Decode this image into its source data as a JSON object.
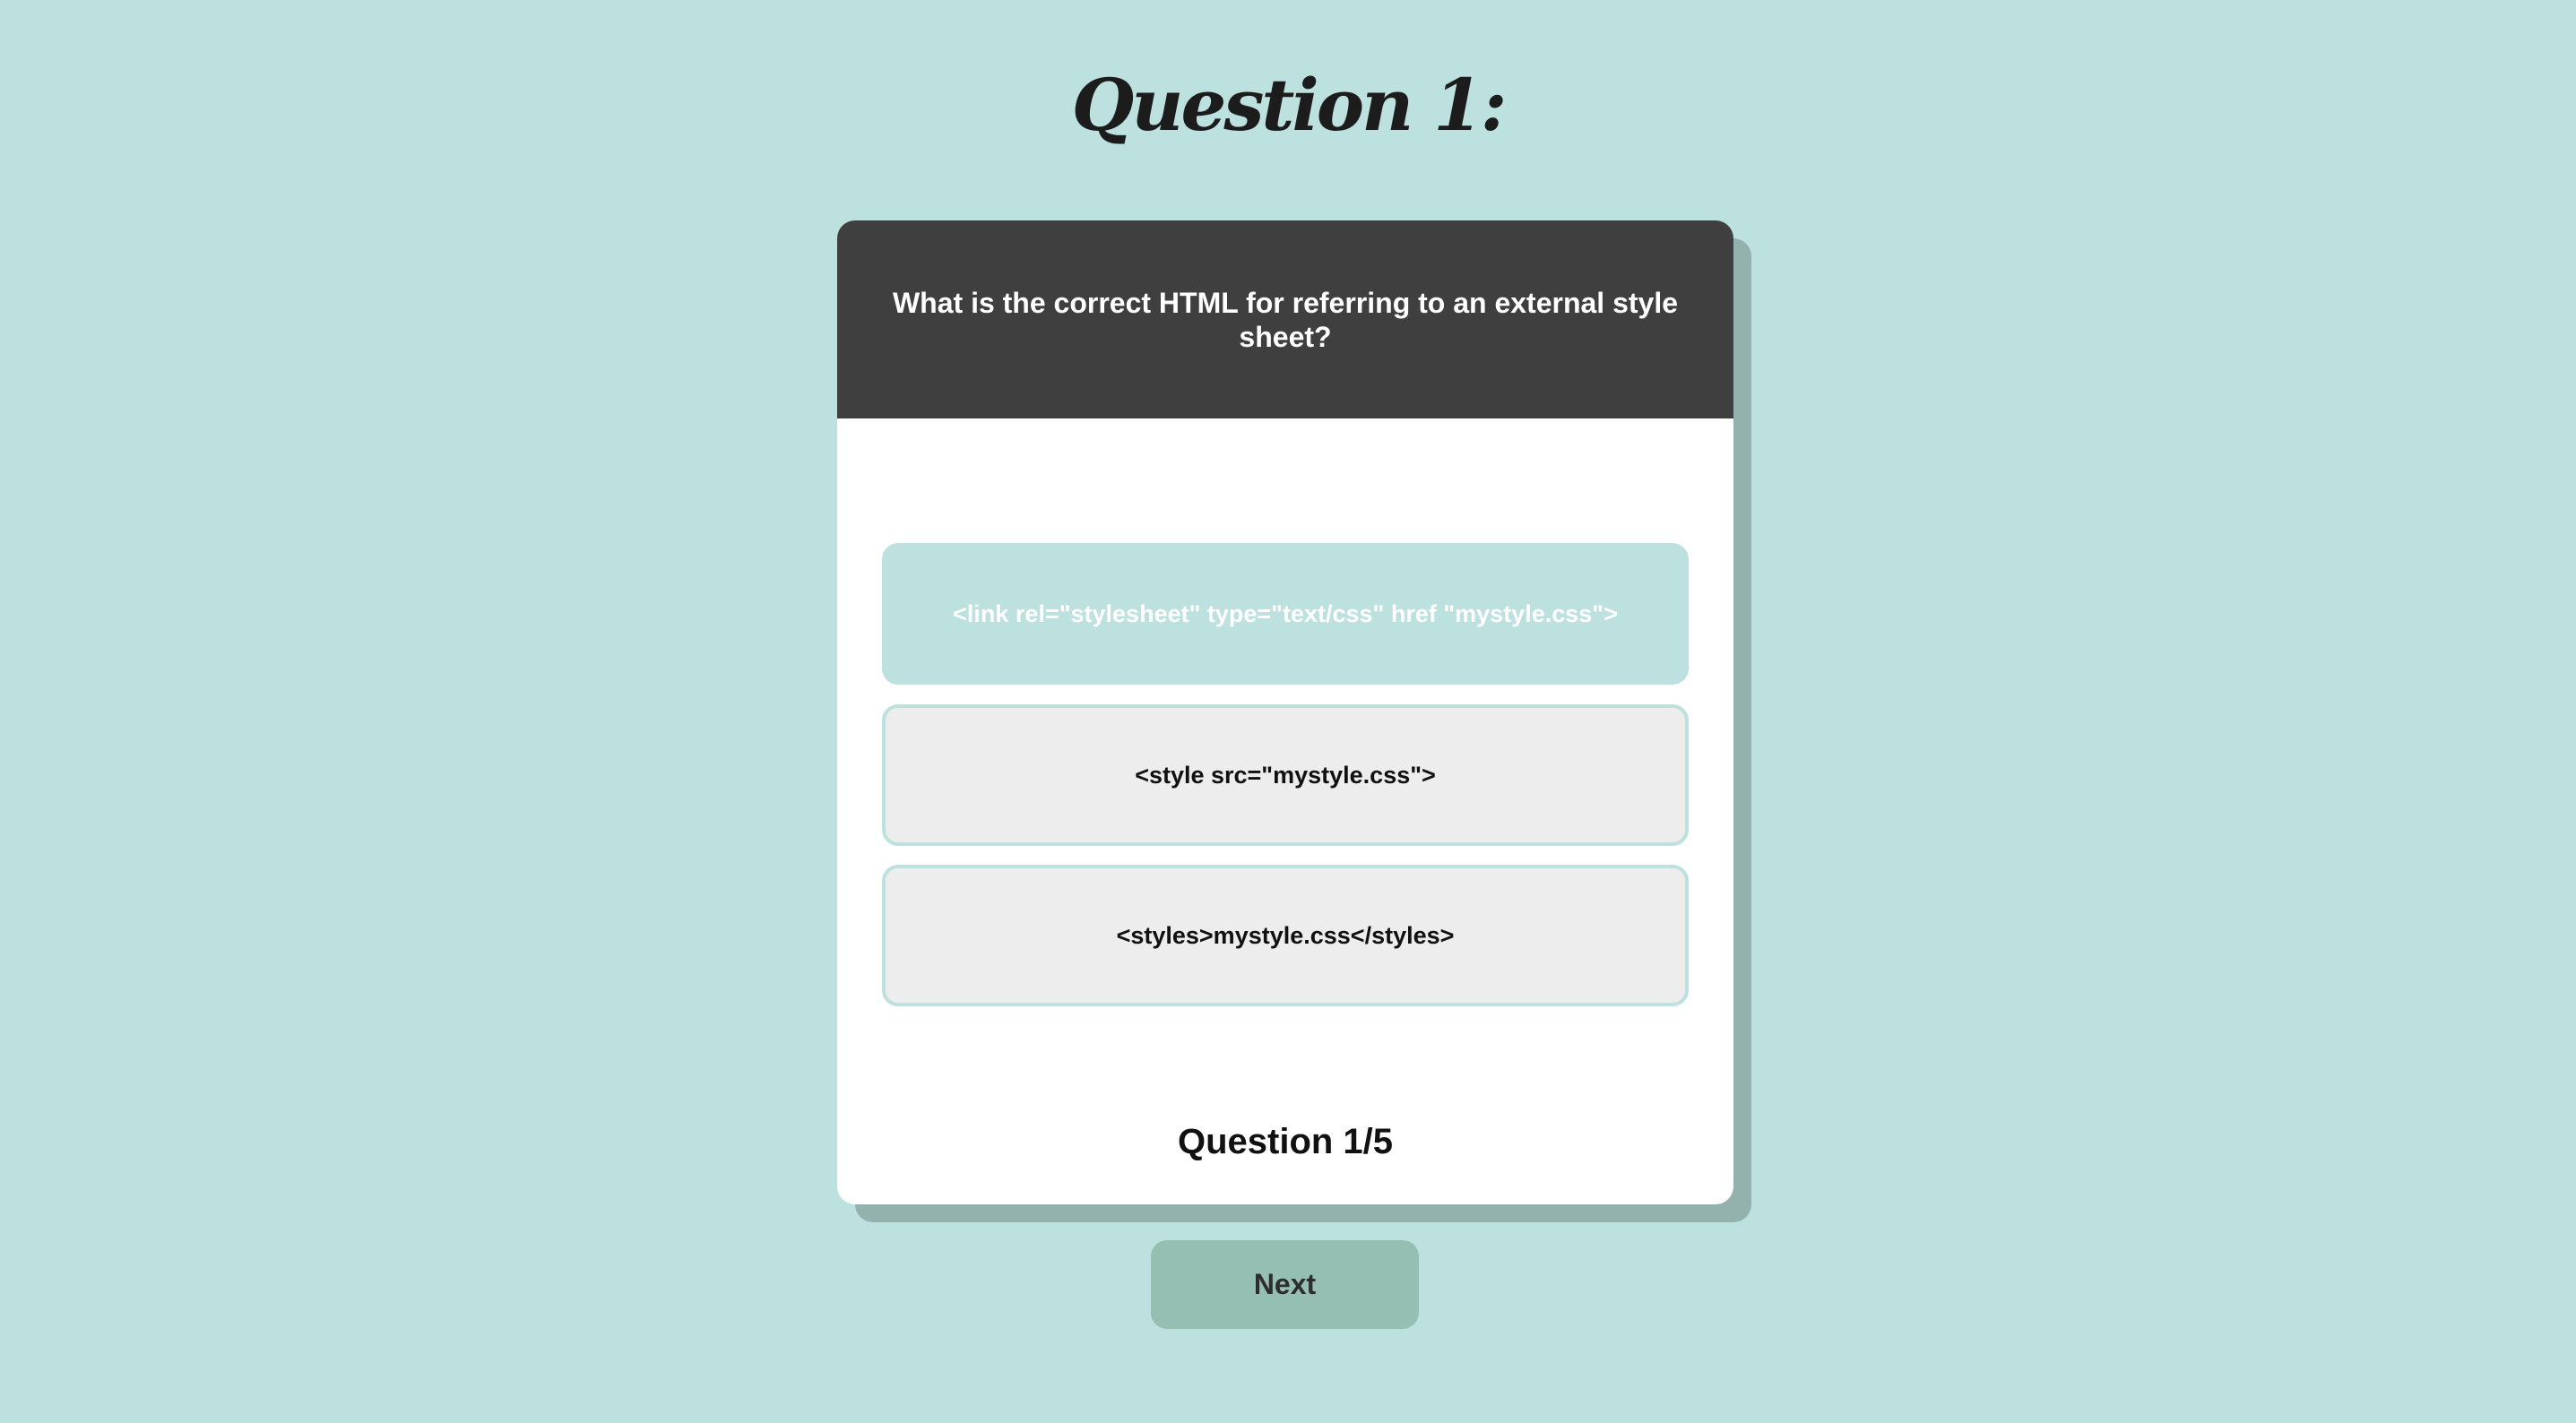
{
  "page": {
    "title": "Question 1:"
  },
  "question": {
    "text": "What is the correct HTML for referring to an external style sheet?"
  },
  "answers": [
    {
      "label": "<link rel=\"stylesheet\" type=\"text/css\" href \"mystyle.css\">",
      "state": "selected"
    },
    {
      "label": "<style src=\"mystyle.css\">",
      "state": "default"
    },
    {
      "label": "<styles>mystyle.css</styles>",
      "state": "default"
    }
  ],
  "progress": {
    "text": "Question 1/5"
  },
  "controls": {
    "next_label": "Next"
  },
  "colors": {
    "background": "#bde1df",
    "header": "#3f3f3f",
    "card": "#ffffff",
    "answer_default": "#ededed",
    "answer_selected": "#bde1df",
    "next_button": "#96bfb3",
    "shadow": "#93b2ae"
  }
}
